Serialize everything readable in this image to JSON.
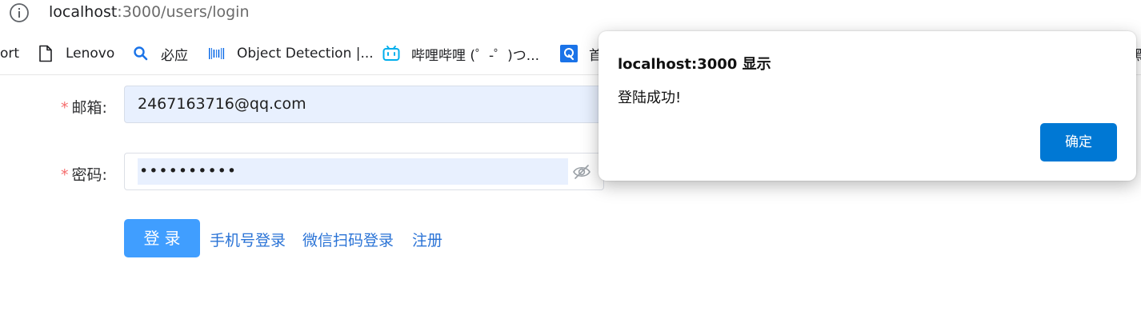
{
  "browser": {
    "url_host": "localhost",
    "url_path": ":3000/users/login",
    "info_icon": "info-circle-icon"
  },
  "bookmarks": [
    {
      "label": "ort",
      "icon": ""
    },
    {
      "label": "Lenovo",
      "icon": "page-icon"
    },
    {
      "label": "必应",
      "icon": "bing-search-icon"
    },
    {
      "label": "Object Detection |...",
      "icon": "barcode-icon"
    },
    {
      "label": "哔哩哔哩 (゜-゜)つ...",
      "icon": "bilibili-tv-icon"
    },
    {
      "label": "首",
      "icon": "q-icon"
    },
    {
      "label": "黑",
      "icon": ""
    }
  ],
  "form": {
    "email_label": "邮箱:",
    "email_value": "2467163716@qq.com",
    "password_label": "密码:",
    "password_value": "••••••••••",
    "required_mark": "*"
  },
  "actions": {
    "login_label": "登录",
    "phone_login": "手机号登录",
    "wechat_login": "微信扫码登录",
    "register": "注册"
  },
  "dialog": {
    "title": "localhost:3000 显示",
    "message": "登陆成功!",
    "ok_label": "确定"
  },
  "colors": {
    "primary": "#409eff",
    "link": "#2a73d6",
    "required": "#f56c6c",
    "dialog_button": "#0078d4",
    "autofill": "#e8f0fe"
  }
}
